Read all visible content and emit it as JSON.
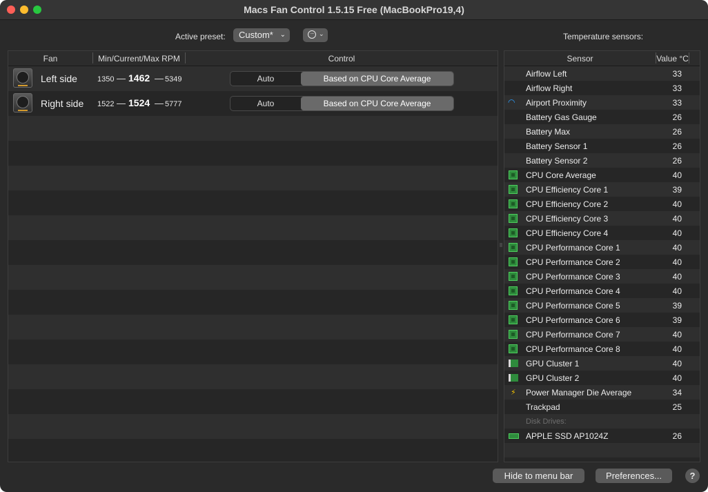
{
  "window": {
    "title": "Macs Fan Control 1.5.15 Free (MacBookPro19,4)"
  },
  "toolbar": {
    "preset_label": "Active preset:",
    "preset_value": "Custom*",
    "sensors_heading": "Temperature sensors:"
  },
  "fan_table": {
    "headers": {
      "fan": "Fan",
      "rpm": "Min/Current/Max RPM",
      "control": "Control"
    },
    "rows": [
      {
        "name": "Left side",
        "min": "1350",
        "current": "1462",
        "max": "5349",
        "auto_label": "Auto",
        "control_label": "Based on CPU Core Average"
      },
      {
        "name": "Right side",
        "min": "1522",
        "current": "1524",
        "max": "5777",
        "auto_label": "Auto",
        "control_label": "Based on CPU Core Average"
      }
    ],
    "dash": "—"
  },
  "sensor_table": {
    "headers": {
      "sensor": "Sensor",
      "value": "Value °C"
    },
    "rows": [
      {
        "name": "Airflow Left",
        "value": "33",
        "icon": "none"
      },
      {
        "name": "Airflow Right",
        "value": "33",
        "icon": "none"
      },
      {
        "name": "Airport Proximity",
        "value": "33",
        "icon": "wifi-icon"
      },
      {
        "name": "Battery Gas Gauge",
        "value": "26",
        "icon": "none"
      },
      {
        "name": "Battery Max",
        "value": "26",
        "icon": "none"
      },
      {
        "name": "Battery Sensor 1",
        "value": "26",
        "icon": "none"
      },
      {
        "name": "Battery Sensor 2",
        "value": "26",
        "icon": "none"
      },
      {
        "name": "CPU Core Average",
        "value": "40",
        "icon": "chip-icon"
      },
      {
        "name": "CPU Efficiency Core 1",
        "value": "39",
        "icon": "chip-icon"
      },
      {
        "name": "CPU Efficiency Core 2",
        "value": "40",
        "icon": "chip-icon"
      },
      {
        "name": "CPU Efficiency Core 3",
        "value": "40",
        "icon": "chip-icon"
      },
      {
        "name": "CPU Efficiency Core 4",
        "value": "40",
        "icon": "chip-icon"
      },
      {
        "name": "CPU Performance Core 1",
        "value": "40",
        "icon": "chip-icon"
      },
      {
        "name": "CPU Performance Core 2",
        "value": "40",
        "icon": "chip-icon"
      },
      {
        "name": "CPU Performance Core 3",
        "value": "40",
        "icon": "chip-icon"
      },
      {
        "name": "CPU Performance Core 4",
        "value": "40",
        "icon": "chip-icon"
      },
      {
        "name": "CPU Performance Core 5",
        "value": "39",
        "icon": "chip-icon"
      },
      {
        "name": "CPU Performance Core 6",
        "value": "39",
        "icon": "chip-icon"
      },
      {
        "name": "CPU Performance Core 7",
        "value": "40",
        "icon": "chip-icon"
      },
      {
        "name": "CPU Performance Core 8",
        "value": "40",
        "icon": "chip-icon"
      },
      {
        "name": "GPU Cluster 1",
        "value": "40",
        "icon": "gpu-icon"
      },
      {
        "name": "GPU Cluster 2",
        "value": "40",
        "icon": "gpu-icon"
      },
      {
        "name": "Power Manager Die Average",
        "value": "34",
        "icon": "bolt-icon"
      },
      {
        "name": "Trackpad",
        "value": "25",
        "icon": "none"
      },
      {
        "name": "Disk Drives:",
        "value": "",
        "icon": "none",
        "group": true
      },
      {
        "name": "APPLE SSD AP1024Z",
        "value": "26",
        "icon": "ssd-icon"
      }
    ]
  },
  "footer": {
    "hide_label": "Hide to menu bar",
    "prefs_label": "Preferences...",
    "help_label": "?"
  }
}
